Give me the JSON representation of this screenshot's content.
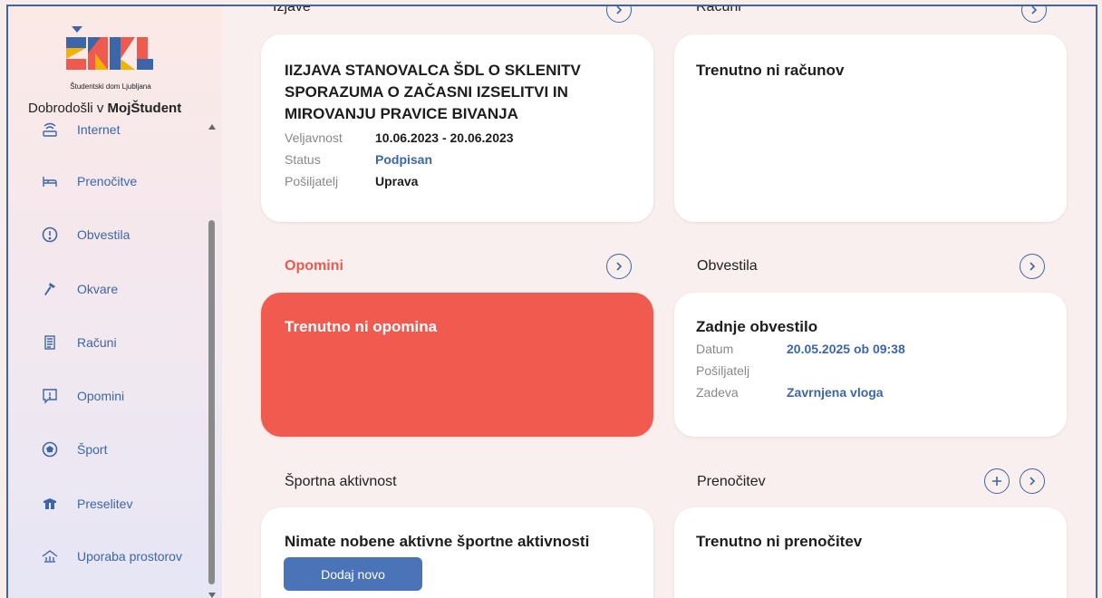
{
  "app": {
    "logo_text": "Študentski dom Ljubljana",
    "welcome_prefix": "Dobrodošli v ",
    "welcome_brand": "MojŠtudent"
  },
  "sidebar": {
    "items": [
      {
        "label": "Internet",
        "icon": "router-icon"
      },
      {
        "label": "Prenočitve",
        "icon": "bed-icon"
      },
      {
        "label": "Obvestila",
        "icon": "alert-circle-icon"
      },
      {
        "label": "Okvare",
        "icon": "hammer-icon"
      },
      {
        "label": "Računi",
        "icon": "receipt-icon"
      },
      {
        "label": "Opomini",
        "icon": "warning-message-icon"
      },
      {
        "label": "Šport",
        "icon": "ball-icon"
      },
      {
        "label": "Preselitev",
        "icon": "box-icon"
      },
      {
        "label": "Uporaba prostorov",
        "icon": "building-icon"
      }
    ]
  },
  "sections": {
    "izjave": {
      "title": "Izjave",
      "card_title": "IIZJAVA STANOVALCA ŠDL O SKLENITV SPORAZUMA O ZAČASNI IZSELITVI IN MIROVANJU PRAVICE BIVANJA",
      "fields": [
        {
          "key": "Veljavnost",
          "value": "10.06.2023 - 20.06.2023"
        },
        {
          "key": "Status",
          "value": "Podpisan"
        },
        {
          "key": "Pošiljatelj",
          "value": "Uprava"
        }
      ]
    },
    "racuni": {
      "title": "Računi",
      "card_title": "Trenutno ni računov"
    },
    "opomini": {
      "title": "Opomini",
      "card_title": "Trenutno ni opomina"
    },
    "obvestila": {
      "title": "Obvestila",
      "card_title": "Zadnje obvestilo",
      "fields": [
        {
          "key": "Datum",
          "value": "20.05.2025 ob 09:38"
        },
        {
          "key": "Pošiljatelj",
          "value": ""
        },
        {
          "key": "Zadeva",
          "value": "Zavrnjena vloga"
        }
      ]
    },
    "sport": {
      "title": "Športna aktivnost",
      "card_title": "Nimate nobene aktivne športne aktivnosti",
      "button": "Dodaj novo"
    },
    "prenocitev": {
      "title": "Prenočitev",
      "card_title": "Trenutno ni prenočitev"
    }
  },
  "colors": {
    "accent": "#3c66a8",
    "danger": "#f05a4f",
    "button": "#4a74b7"
  }
}
